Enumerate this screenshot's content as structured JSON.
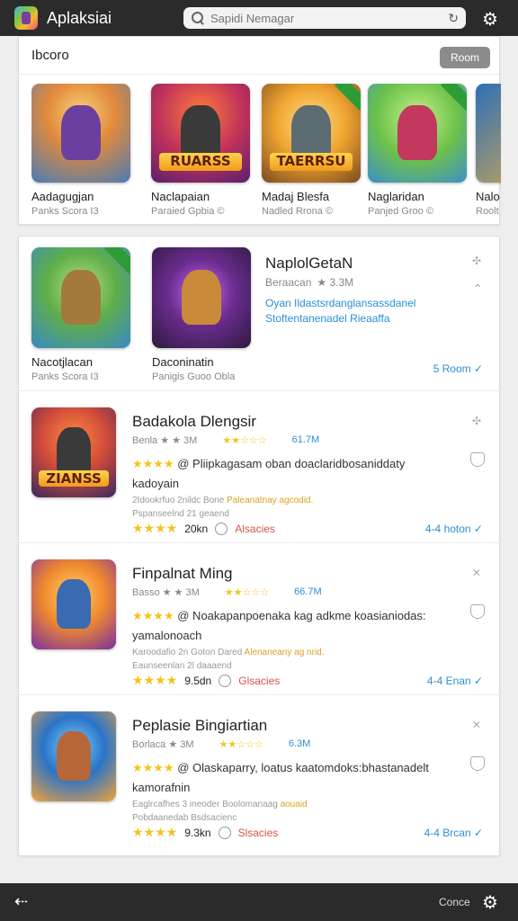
{
  "header": {
    "app_title": "Aplaksiai",
    "search_placeholder": "Sapidi Nemagar"
  },
  "featured": {
    "title": "Ibcoro",
    "more_label": "Room",
    "items": [
      {
        "name": "Aadagugjan",
        "sub": "Panks Scora I3"
      },
      {
        "name": "Naclapaian",
        "sub": "Paraied Gpbia ©",
        "banner": "RUARSS"
      },
      {
        "name": "Madaj Blesfa",
        "sub": "Nadled Rrona ©",
        "banner": "TAERRSU"
      },
      {
        "name": "Naglaridan",
        "sub": "Panjed Groo ©"
      },
      {
        "name": "Nalo",
        "sub": "Roolt"
      }
    ]
  },
  "spotlight": {
    "items": [
      {
        "name": "Nacotjlacan",
        "sub": "Panks Scora I3"
      },
      {
        "name": "Daconinatin",
        "sub": "Panigis Guoo Obla"
      }
    ],
    "title": "NaplolGetaN",
    "subtitle": "Beraacan",
    "rating": "★ 3.3M",
    "description": "Oyan Ildastsrdanglansassdanel Stoftentanenadel Rieaaffa",
    "link": "5 Room ✓"
  },
  "apps": [
    {
      "title": "Badakola Dlengsir",
      "meta_left": "Benla ★ ★ 3M",
      "rating_stars": "★★☆☆☆",
      "size": "61.7M",
      "desc_stars": "★★★★",
      "description": "@ Pliipkagasam oban doaclaridbosaniddaty kadoyain",
      "note1": "2Idookrfuo 2nildc Bone",
      "note1_hl": "Paleanatnay agcodid.",
      "note2": "Pspanseelnd 21 geaend",
      "foot_stars": "★★★★",
      "foot_count": "20kn",
      "foot_sales": "Alsacies",
      "link": "4-4 hoton ✓",
      "banner": "ZIANSS"
    },
    {
      "title": "Finpalnat Ming",
      "meta_left": "Basso ★ ★ 3M",
      "rating_stars": "★★☆☆☆",
      "size": "66.7M",
      "desc_stars": "★★★★",
      "description": "@ Noakapanpoenaka kag adkme koasianiodas: yamalonoach",
      "note1": "Karoodafio 2n Goton Dared",
      "note1_hl": "Alenaneany ag nrid.",
      "note2": "Eaunseenlan 2l daaaend",
      "foot_stars": "★★★★",
      "foot_count": "9.5dn",
      "foot_sales": "Glsacies",
      "link": "4-4 Enan ✓",
      "banner": ""
    },
    {
      "title": "Peplasie Bingiartian",
      "meta_left": "Borlaca ★ 3M",
      "rating_stars": "★★☆☆☆",
      "size": "6.3M",
      "desc_stars": "★★★★",
      "description": "@ Olaskaparry, loatus kaatomdoks:bhastanadelt kamorafnin",
      "note1": "Eaglrcafhes 3 ineoder Boolomanaag",
      "note1_hl": "aouaid",
      "note2": "Pobdaanedab Bsdsacienc",
      "foot_stars": "★★★★",
      "foot_count": "9.3kn",
      "foot_sales": "Slsacies",
      "link": "4-4 Brcan ✓",
      "banner": ""
    }
  ],
  "footer": {
    "done_label": "Conce"
  },
  "colors": {
    "accent": "#2a8fd6",
    "star": "#f6c21b",
    "bar": "#2b2b2b"
  }
}
